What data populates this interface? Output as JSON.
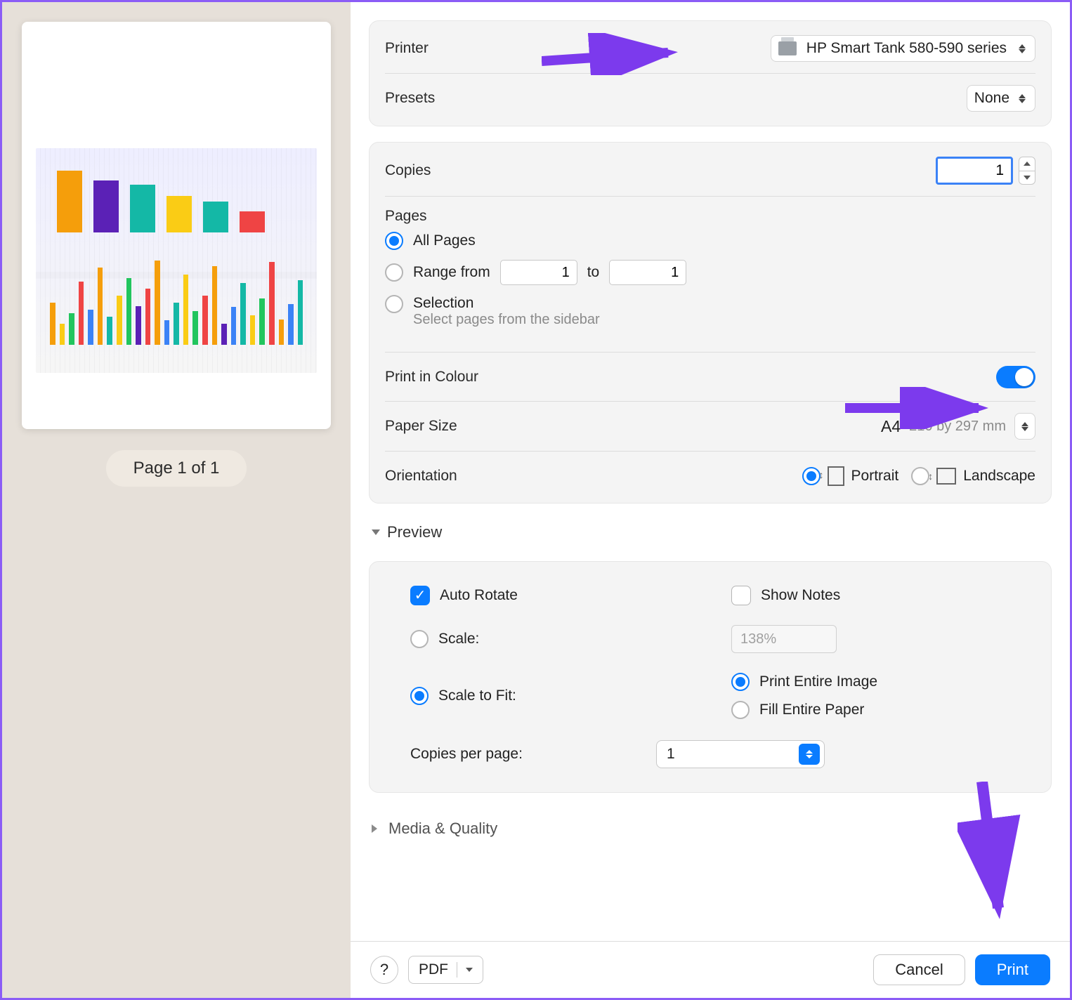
{
  "sidebar": {
    "page_indicator": "Page 1 of 1"
  },
  "printer": {
    "label": "Printer",
    "value": "HP Smart Tank 580-590 series"
  },
  "presets": {
    "label": "Presets",
    "value": "None"
  },
  "copies": {
    "label": "Copies",
    "value": "1"
  },
  "pages": {
    "label": "Pages",
    "all_label": "All Pages",
    "range_from_label": "Range from",
    "range_to_label": "to",
    "range_from_value": "1",
    "range_to_value": "1",
    "selection_label": "Selection",
    "selection_hint": "Select pages from the sidebar"
  },
  "print_colour": {
    "label": "Print in Colour"
  },
  "paper_size": {
    "label": "Paper Size",
    "value": "A4",
    "dims": "210 by 297 mm"
  },
  "orientation": {
    "label": "Orientation",
    "portrait_label": "Portrait",
    "landscape_label": "Landscape"
  },
  "preview": {
    "title": "Preview",
    "auto_rotate": "Auto Rotate",
    "show_notes": "Show Notes",
    "scale_label": "Scale:",
    "scale_value": "138%",
    "scale_to_fit": "Scale to Fit:",
    "print_entire": "Print Entire Image",
    "fill_paper": "Fill Entire Paper",
    "copies_per_page_label": "Copies per page:",
    "copies_per_page_value": "1"
  },
  "media_quality": {
    "title": "Media & Quality"
  },
  "footer": {
    "help": "?",
    "pdf": "PDF",
    "cancel": "Cancel",
    "print": "Print"
  }
}
